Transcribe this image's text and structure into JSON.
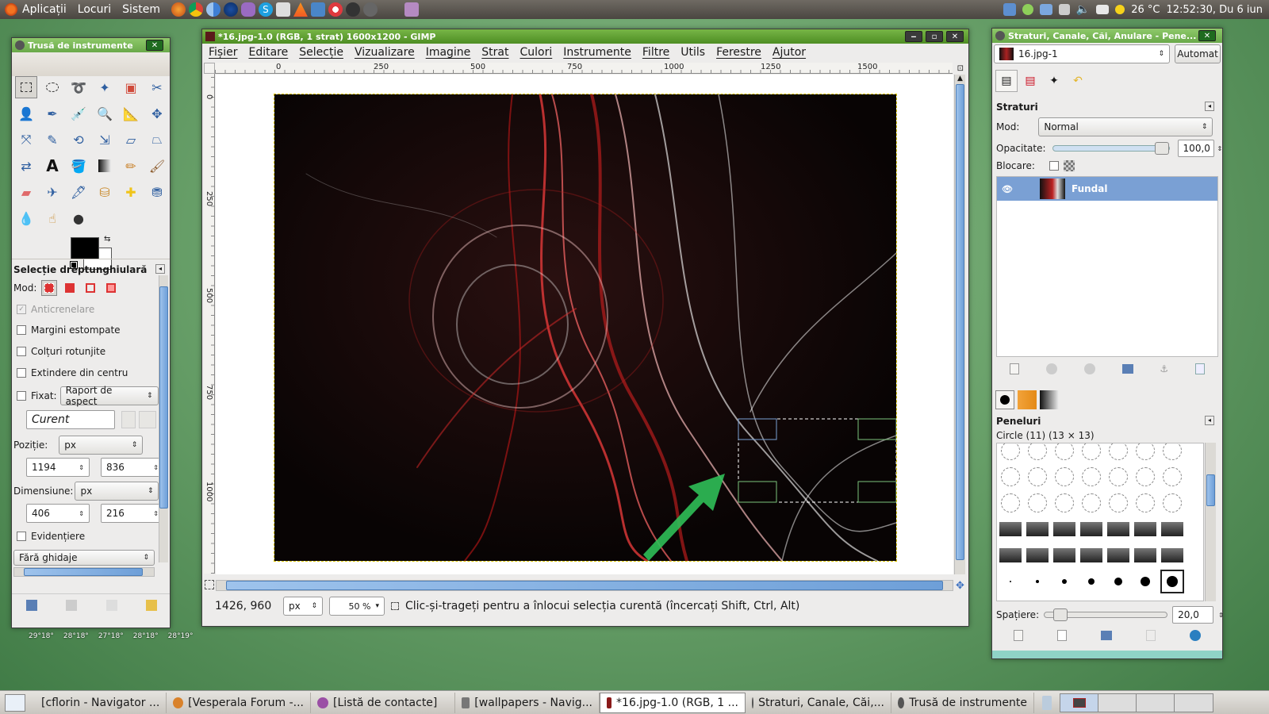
{
  "topbar": {
    "menus": [
      "Aplicații",
      "Locuri",
      "Sistem"
    ],
    "weather": "26 °C",
    "clock": "12:52:30, Du  6 iun"
  },
  "toolbox": {
    "title": "Trusă de instrumente",
    "tool_options_title": "Selecție dreptunghiulară",
    "mode_label": "Mod:",
    "antialias": "Anticrenelare",
    "feather": "Margini estompate",
    "rounded": "Colțuri rotunjite",
    "expand_center": "Extindere din centru",
    "fixed_label": "Fixat:",
    "fixed_value": "Raport de aspect",
    "current_value": "Curent",
    "position_label": "Poziție:",
    "position_unit": "px",
    "pos_x": "1194",
    "pos_y": "836",
    "size_label": "Dimensiune:",
    "size_unit": "px",
    "size_w": "406",
    "size_h": "216",
    "highlight": "Evidențiere",
    "guides": "Fără ghidaje",
    "forecast": [
      "29°18°",
      "28°18°",
      "27°18°",
      "28°18°",
      "28°19°"
    ]
  },
  "gimp": {
    "title": "*16.jpg-1.0 (RGB, 1 strat) 1600x1200 - GIMP",
    "menus": [
      "Fișier",
      "Editare",
      "Selecție",
      "Vizualizare",
      "Imagine",
      "Strat",
      "Culori",
      "Instrumente",
      "Filtre",
      "Utils",
      "Ferestre",
      "Ajutor"
    ],
    "ruler_h": [
      "0",
      "250",
      "500",
      "750",
      "1000",
      "1250",
      "1500"
    ],
    "ruler_v": [
      "0",
      "250",
      "500",
      "750",
      "1000"
    ],
    "coords": "1426, 960",
    "unit": "px",
    "zoom": "50 %",
    "status": "Clic-și-trageți pentru a înlocui selecția curentă (încercați Shift, Ctrl, Alt)"
  },
  "layers_dock": {
    "title": "Straturi, Canale, Căi, Anulare - Pene...",
    "image_select": "16.jpg-1",
    "auto_button": "Automat",
    "layers_title": "Straturi",
    "mode_label": "Mod:",
    "mode_value": "Normal",
    "opacity_label": "Opacitate:",
    "opacity_value": "100,0",
    "opacity_fraction": 1.0,
    "lock_label": "Blocare:",
    "layer_name": "Fundal",
    "brushes_title": "Peneluri",
    "brush_name": "Circle (11) (13 × 13)",
    "spacing_label": "Spațiere:",
    "spacing_value": "20,0",
    "spacing_fraction": 0.08
  },
  "taskbar": {
    "tasks": [
      {
        "label": "[cflorin - Navigator ...",
        "color": "#6a6a6a"
      },
      {
        "label": "[Vesperala Forum -...",
        "color": "#d9822b"
      },
      {
        "label": "[Listă de contacte]",
        "color": "#9a4fa5"
      },
      {
        "label": "[wallpapers - Navig...",
        "color": "#6a6a6a"
      },
      {
        "label": "*16.jpg-1.0 (RGB, 1 ...",
        "color": "#8a1a1a"
      },
      {
        "label": "Straturi, Canale, Căi,...",
        "color": "#555"
      },
      {
        "label": "Trusă de instrumente",
        "color": "#555"
      }
    ]
  },
  "colors": {
    "titlebar": "#5e9f33",
    "selection_blue": "#7aa0d4",
    "fg_color": "#000000",
    "bg_color": "#ffffff",
    "arrow": "#2fbf58"
  }
}
